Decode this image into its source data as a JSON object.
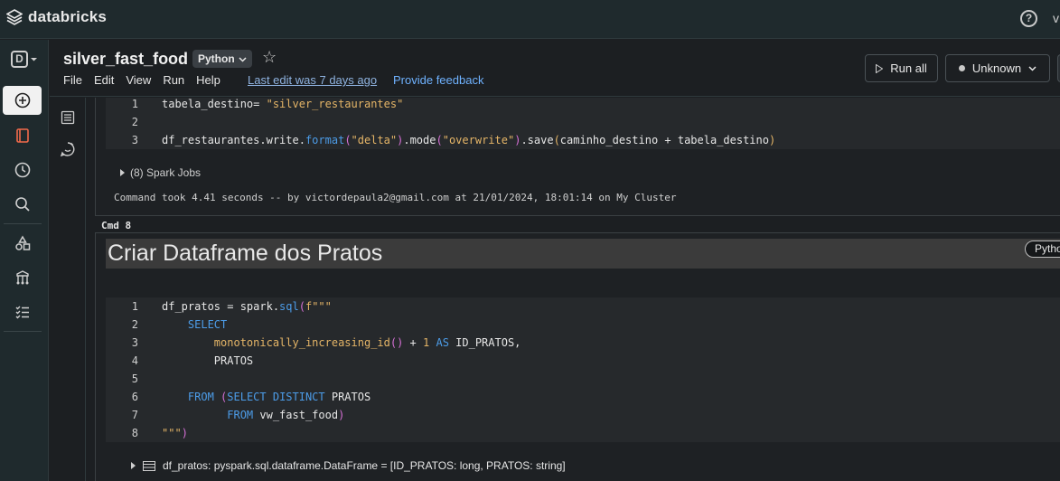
{
  "app": {
    "brand": "databricks",
    "user_initial": "v"
  },
  "notebook": {
    "title": "silver_fast_food",
    "language": "Python",
    "menu": [
      "File",
      "Edit",
      "View",
      "Run",
      "Help"
    ],
    "last_edit": "Last edit was 7 days ago",
    "feedback": "Provide feedback",
    "run_all": "Run all",
    "cluster_status": "Unknown"
  },
  "cell7": {
    "lines": [
      {
        "n": "1",
        "parts": [
          [
            "tabela_destino= ",
            ""
          ],
          [
            "\"silver_restaurantes\"",
            "st"
          ]
        ]
      },
      {
        "n": "2",
        "parts": []
      },
      {
        "n": "3",
        "parts": [
          [
            "df_restaurantes.write.",
            ""
          ],
          [
            "format",
            "kw"
          ],
          [
            "(",
            "pn"
          ],
          [
            "\"delta\"",
            "st"
          ],
          [
            ")",
            "pn"
          ],
          [
            ".mode",
            ""
          ],
          [
            "(",
            "pn"
          ],
          [
            "\"overwrite\"",
            "st"
          ],
          [
            ")",
            "pn"
          ],
          [
            ".save",
            ""
          ],
          [
            "(",
            "pp"
          ],
          [
            "caminho_destino + tabela_destino",
            ""
          ],
          [
            ")",
            "pp"
          ]
        ]
      }
    ],
    "spark_jobs": "(8) Spark Jobs",
    "command_took": "Command took 4.41 seconds -- by victordepaula2@gmail.com at 21/01/2024, 18:01:14 on My Cluster"
  },
  "cell8": {
    "label": "Cmd 8",
    "markdown_title": "Criar Dataframe dos Pratos",
    "badge": "Python",
    "lines": [
      {
        "n": "1",
        "parts": [
          [
            "df_pratos = spark.",
            ""
          ],
          [
            "sql",
            "kw"
          ],
          [
            "(",
            "pn"
          ],
          [
            "f\"\"\"",
            "st"
          ]
        ]
      },
      {
        "n": "2",
        "parts": [
          [
            "    SELECT",
            "kw"
          ]
        ]
      },
      {
        "n": "3",
        "parts": [
          [
            "        monotonically_increasing_id",
            "fn"
          ],
          [
            "()",
            "pn"
          ],
          [
            " + ",
            ""
          ],
          [
            "1",
            "nm"
          ],
          [
            " AS ",
            "kw"
          ],
          [
            "ID_PRATOS,",
            ""
          ]
        ]
      },
      {
        "n": "4",
        "parts": [
          [
            "        PRATOS",
            ""
          ]
        ]
      },
      {
        "n": "5",
        "parts": []
      },
      {
        "n": "6",
        "parts": [
          [
            "    FROM ",
            "kw"
          ],
          [
            "(",
            "pn"
          ],
          [
            "SELECT DISTINCT ",
            "kw"
          ],
          [
            "PRATOS",
            ""
          ]
        ]
      },
      {
        "n": "7",
        "parts": [
          [
            "          FROM ",
            "kw"
          ],
          [
            "vw_fast_food",
            ""
          ],
          [
            ")",
            "pn"
          ]
        ]
      },
      {
        "n": "8",
        "parts": [
          [
            "\"\"\"",
            "st"
          ],
          [
            ")",
            "pn"
          ]
        ]
      }
    ],
    "df_output": "df_pratos:  pyspark.sql.dataframe.DataFrame = [ID_PRATOS: long, PRATOS: string]"
  }
}
